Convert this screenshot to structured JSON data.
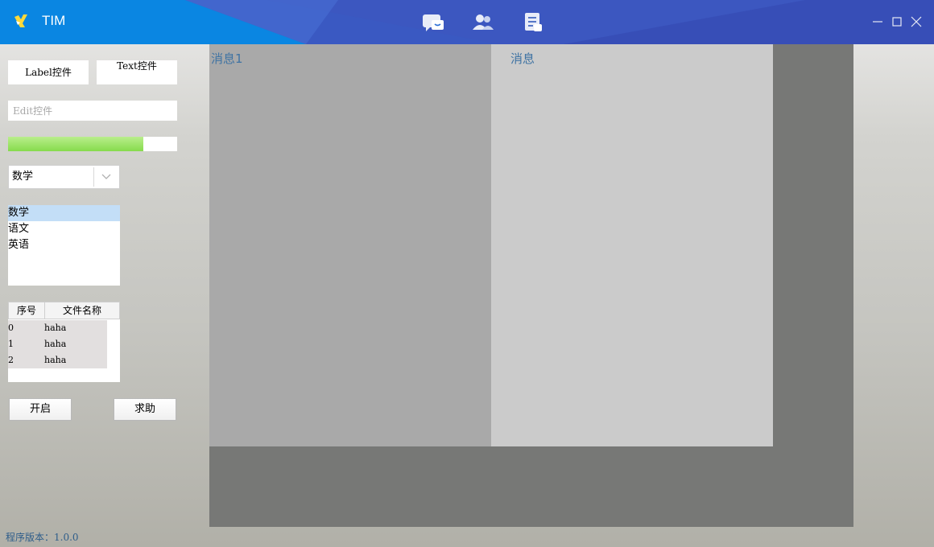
{
  "window": {
    "title": "TIM",
    "accent_color": "#0a86e2",
    "nav_icons": [
      "chat-icon",
      "contacts-icon",
      "notes-icon"
    ]
  },
  "controls": {
    "label_text": "Label控件",
    "text_text": "Text控件",
    "edit_placeholder": "Edit控件",
    "progress_value": 0.8,
    "combo_value": "数学",
    "list_items": [
      "数学",
      "语文",
      "英语"
    ],
    "table": {
      "columns": [
        "序号",
        "文件名称"
      ],
      "rows": [
        [
          "0",
          "haha"
        ],
        [
          "1",
          "haha"
        ],
        [
          "2",
          "haha"
        ]
      ]
    },
    "buttons": {
      "open": "开启",
      "help": "求助"
    }
  },
  "panels": {
    "left_title": "消息1",
    "right_title": "消息"
  },
  "status": {
    "version": "程序版本：1.0.0"
  }
}
